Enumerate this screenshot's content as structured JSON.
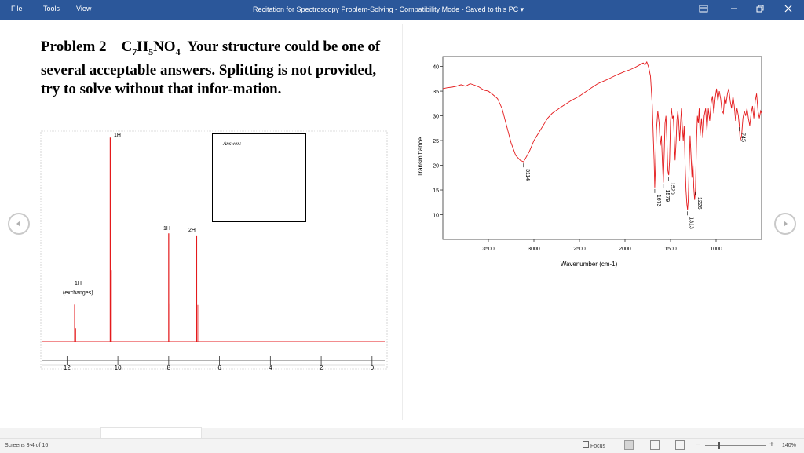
{
  "menu": {
    "file": "File",
    "tools": "Tools",
    "view": "View"
  },
  "window": {
    "title": "Recitation for Spectroscopy Problem-Solving  -  Compatibility Mode  -  Saved to this PC",
    "title_arrow": "▾"
  },
  "problem": {
    "label": "Problem 2",
    "formula_parts": [
      "C",
      "7",
      "H",
      "5",
      "NO",
      "4"
    ],
    "text": "Your structure could be one of several acceptable answers.  Splitting is not provided, try to solve without that infor-mation."
  },
  "answer_label": "Answer:",
  "nmr": {
    "peak_labels": [
      "1H",
      "1H",
      "2H",
      "1H",
      "(exchanges)"
    ],
    "ticks": [
      "12",
      "10",
      "8",
      "6",
      "4",
      "2",
      "0"
    ]
  },
  "ir": {
    "ylabel": "Transmittance",
    "xlabel": "Wavenumber (cm-1)",
    "xticks": [
      "3500",
      "3000",
      "2500",
      "2000",
      "1500",
      "1000"
    ],
    "yticks": [
      "10",
      "15",
      "20",
      "25",
      "30",
      "35",
      "40"
    ],
    "peak_labels": [
      "3114",
      "1673",
      "1579",
      "1520",
      "1313",
      "1226",
      "745"
    ]
  },
  "status": {
    "screens": "Screens 3-4 of 16",
    "focus": "Focus",
    "zoom_minus": "−",
    "zoom_plus": "+",
    "zoom": "140%"
  },
  "chart_data": [
    {
      "type": "line",
      "title": "",
      "xlabel": "Wavenumber (cm-1)",
      "ylabel": "Transmittance",
      "xlim": [
        4000,
        500
      ],
      "ylim": [
        5,
        42
      ],
      "series": [
        {
          "x": [
            4000,
            3950,
            3900,
            3850,
            3800,
            3750,
            3700,
            3650,
            3600,
            3550,
            3500,
            3450,
            3400,
            3350,
            3300,
            3250,
            3200,
            3150,
            3114,
            3080,
            3050,
            3000,
            2950,
            2900,
            2850,
            2800,
            2700,
            2600,
            2500,
            2400,
            2300,
            2200,
            2100,
            2000,
            1950,
            1900,
            1850,
            1800,
            1780,
            1760,
            1740,
            1720,
            1700,
            1690,
            1680,
            1673,
            1665,
            1655,
            1640,
            1625,
            1612,
            1600,
            1590,
            1579,
            1570,
            1560,
            1550,
            1540,
            1530,
            1520,
            1510,
            1500,
            1490,
            1480,
            1470,
            1460,
            1450,
            1440,
            1430,
            1420,
            1410,
            1400,
            1390,
            1380,
            1370,
            1360,
            1350,
            1340,
            1330,
            1320,
            1313,
            1305,
            1295,
            1285,
            1275,
            1265,
            1255,
            1245,
            1235,
            1226,
            1215,
            1205,
            1195,
            1185,
            1175,
            1160,
            1145,
            1130,
            1115,
            1100,
            1085,
            1070,
            1055,
            1040,
            1025,
            1010,
            995,
            980,
            965,
            950,
            935,
            920,
            905,
            890,
            875,
            860,
            845,
            830,
            815,
            800,
            785,
            770,
            755,
            745,
            735,
            720,
            705,
            690,
            675,
            660,
            645,
            630,
            615,
            600,
            585,
            570,
            555,
            540,
            525,
            510,
            500
          ],
          "y": [
            35.5,
            35.7,
            35.8,
            36.0,
            36.3,
            36.0,
            36.5,
            36.2,
            35.8,
            35.2,
            35.0,
            34.3,
            33.5,
            31.5,
            28.0,
            24.5,
            22.0,
            21.0,
            20.7,
            21.8,
            22.8,
            25.0,
            26.5,
            28.0,
            29.5,
            30.5,
            31.8,
            33.0,
            34.0,
            35.3,
            36.5,
            37.3,
            38.2,
            39.0,
            39.3,
            39.7,
            40.2,
            40.7,
            40.3,
            40.9,
            39.8,
            38.0,
            32.0,
            26.0,
            21.0,
            15.5,
            20.0,
            27.0,
            31.0,
            28.5,
            24.0,
            26.0,
            21.0,
            16.5,
            22.0,
            28.5,
            30.0,
            25.0,
            19.0,
            18.0,
            21.0,
            29.0,
            31.5,
            29.5,
            30.0,
            26.0,
            21.0,
            24.5,
            29.0,
            31.0,
            29.0,
            25.0,
            28.5,
            31.5,
            27.5,
            25.0,
            28.0,
            20.0,
            15.0,
            12.0,
            11.0,
            13.0,
            20.0,
            26.0,
            22.0,
            17.5,
            21.0,
            15.5,
            13.0,
            15.0,
            25.0,
            30.0,
            28.5,
            31.5,
            26.0,
            29.5,
            25.5,
            30.0,
            31.5,
            27.0,
            31.5,
            29.0,
            32.5,
            34.0,
            30.5,
            33.5,
            35.5,
            33.0,
            35.0,
            33.5,
            31.0,
            30.5,
            34.0,
            32.5,
            34.5,
            35.5,
            33.0,
            31.5,
            34.0,
            32.0,
            29.0,
            31.5,
            30.0,
            28.0,
            25.0,
            26.0,
            29.5,
            31.0,
            30.0,
            31.5,
            29.5,
            28.0,
            30.5,
            32.0,
            29.5,
            33.0,
            34.5,
            31.0,
            29.5,
            31.0,
            30.5
          ]
        }
      ],
      "peak_labels_at": [
        3114,
        1673,
        1579,
        1520,
        1313,
        1226,
        745
      ]
    },
    {
      "type": "line",
      "title": "",
      "xlim": [
        13,
        -0.5
      ],
      "peaks": [
        {
          "ppm": 11.7,
          "label": "1H (exchanges)",
          "height": 0.18
        },
        {
          "ppm": 10.3,
          "label": "1H",
          "height": 0.98
        },
        {
          "ppm": 8.0,
          "label": "1H",
          "height": 0.52
        },
        {
          "ppm": 6.9,
          "label": "2H",
          "height": 0.51
        }
      ],
      "ticks": [
        12,
        10,
        8,
        6,
        4,
        2,
        0
      ]
    }
  ]
}
